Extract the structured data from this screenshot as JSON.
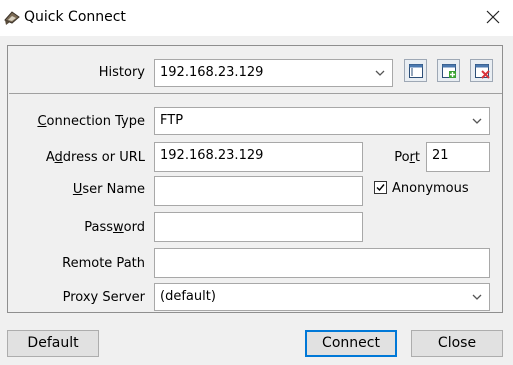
{
  "window": {
    "title": "Quick Connect"
  },
  "history": {
    "label": "History",
    "value": "192.168.23.129",
    "buttons": [
      "new-icon",
      "add-icon",
      "delete-icon"
    ]
  },
  "form": {
    "connection_type": {
      "label_pre": "",
      "label_ul": "C",
      "label_post": "onnection Type",
      "value": "FTP"
    },
    "address": {
      "label_pre": "A",
      "label_ul": "d",
      "label_post": "dress or URL",
      "value": "192.168.23.129"
    },
    "port": {
      "label_pre": "Po",
      "label_ul": "r",
      "label_post": "t",
      "value": "21"
    },
    "user_name": {
      "label_pre": "",
      "label_ul": "U",
      "label_post": "ser Name",
      "value": ""
    },
    "anonymous": {
      "label": "Anonymous",
      "checked": true
    },
    "password": {
      "label_pre": "Pass",
      "label_ul": "w",
      "label_post": "ord",
      "value": ""
    },
    "remote_path": {
      "label": "Remote Path",
      "value": ""
    },
    "proxy_server": {
      "label": "Proxy Server",
      "value": "(default)"
    }
  },
  "footer": {
    "default_label": "Default",
    "connect_label": "Connect",
    "close_label": "Close"
  },
  "colors": {
    "accent": "#0078d7",
    "delete_red": "#d9343b",
    "add_green": "#3aa335"
  }
}
